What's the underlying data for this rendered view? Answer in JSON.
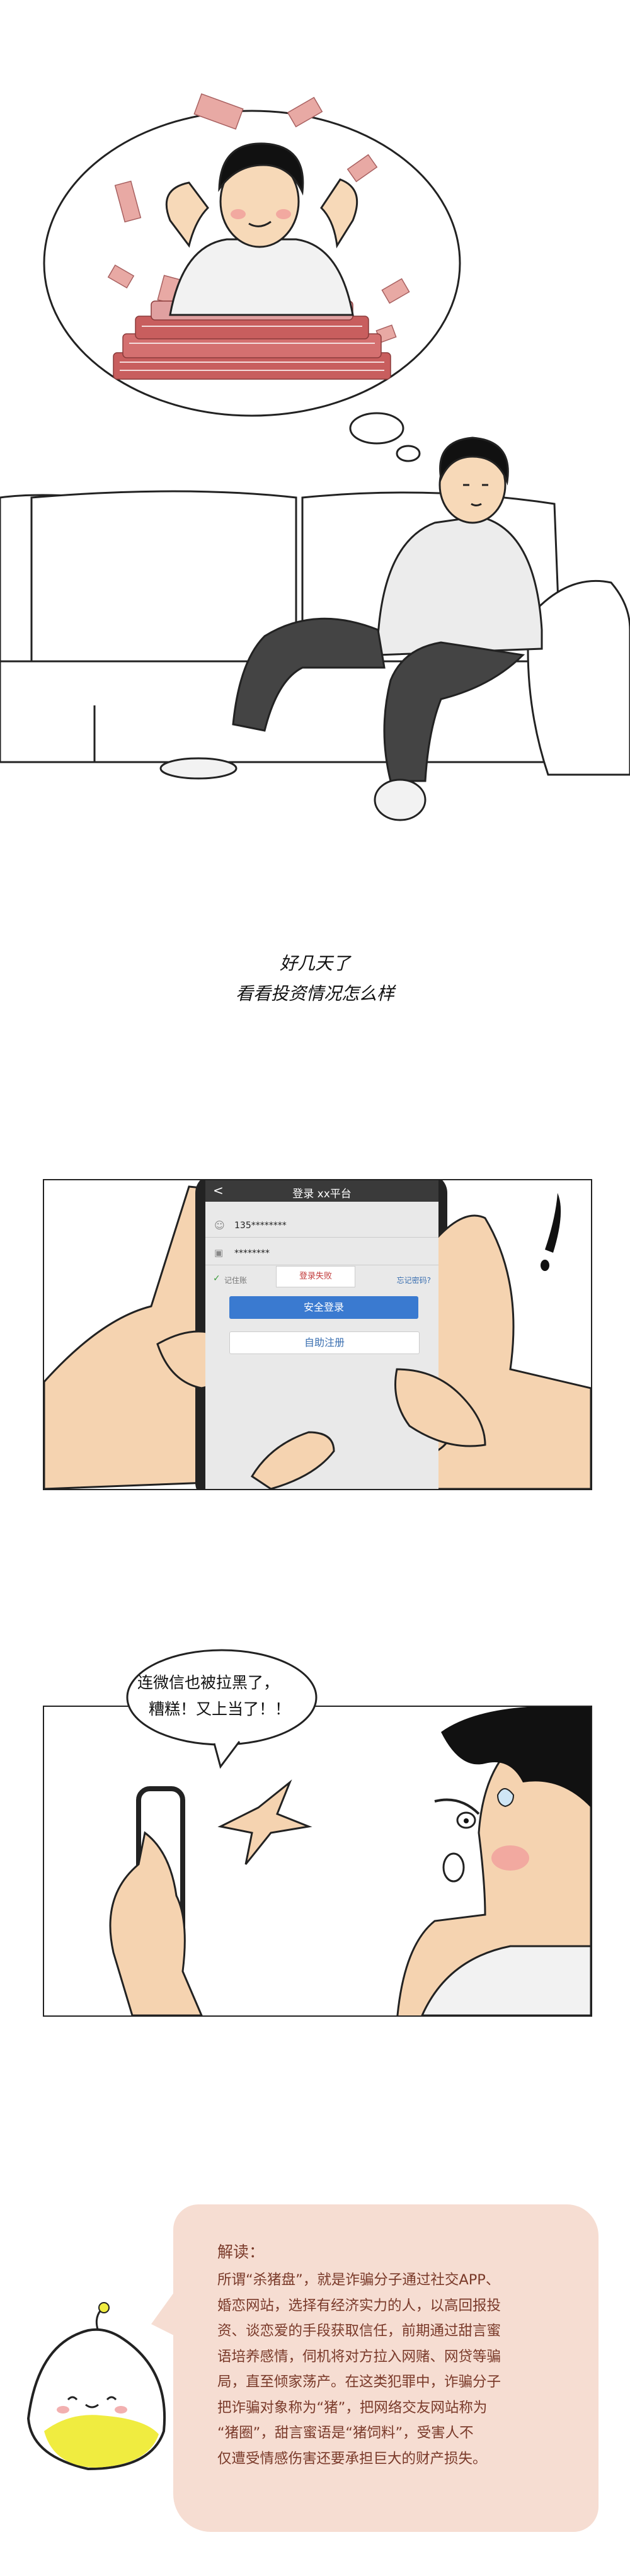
{
  "scene1": {
    "caption_line1": "好几天了",
    "caption_line2": "看看投资情况怎么样"
  },
  "scene2": {
    "app_title": "登录 xx平台",
    "phone_field": "135********",
    "password_field": "********",
    "remember_label": "记住账",
    "forgot_link": "忘记密码?",
    "error_popup": "登录失败",
    "login_button": "安全登录",
    "register_button": "自助注册"
  },
  "scene3": {
    "speech_line1": "连微信也被拉黑了，",
    "speech_line2": "糟糕！又上当了！！"
  },
  "note": {
    "title": "解读：",
    "lines": [
      "所谓“杀猪盘”，就是诈骗分子通过社交APP、",
      "婚恋网站，选择有经济实力的人，以高回报投",
      "资、谈恋爱的手段获取信任，前期通过甜言蜜",
      "语培养感情，伺机将对方拉入网赌、网贷等骗",
      "局，直至倾家荡产。在这类犯罪中，诈骗分子",
      "把诈骗对象称为“猪”，把网络交友网站称为",
      "“猪圈”，甜言蜜语是“猪饲料”，受害人不",
      "仅遭受情感伤害还要承担巨大的财产损失。"
    ],
    "colors": {
      "card": "#f6ddd2",
      "text": "#7a3a2a"
    }
  }
}
